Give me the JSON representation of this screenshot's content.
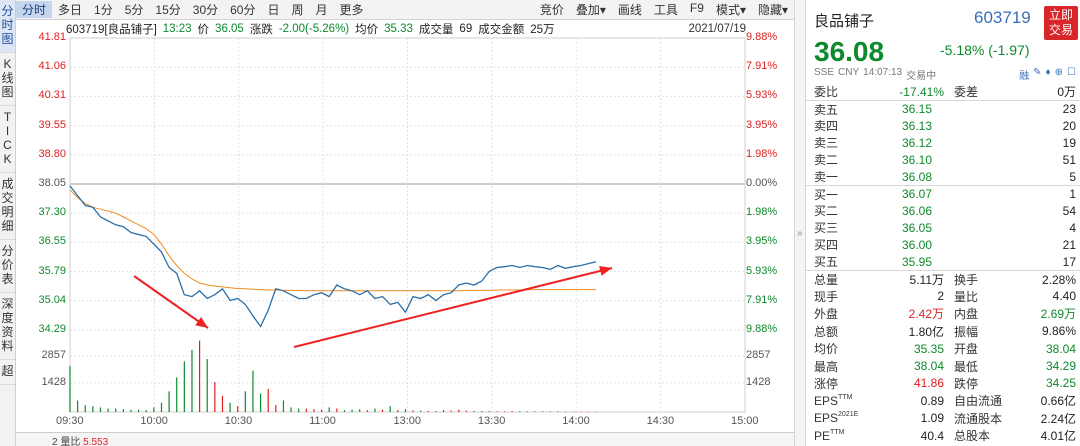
{
  "vtabs": [
    "分\n时\n图",
    "K\n线\n图",
    "T\nI\nC\nK",
    "成\n交\n明\n细",
    "分\n价\n表",
    "深\n度\n资\n料",
    "超"
  ],
  "toolbar": {
    "left": [
      "分时",
      "多日",
      "1分",
      "5分",
      "15分",
      "30分",
      "60分",
      "日",
      "周",
      "月",
      "更多"
    ],
    "right": [
      "竞价",
      "叠加▾",
      "画线",
      "工具",
      "F9",
      "模式▾",
      "隐藏▾"
    ]
  },
  "info": {
    "code_name": "603719[良品铺子]",
    "time": "13:23",
    "price_label": "价",
    "price": "36.05",
    "chg_label": "涨跌",
    "chg": "-2.00(-5.26%)",
    "avg_label": "均价",
    "avg": "35.33",
    "vol_label": "成交量",
    "vol": "69",
    "amt_label": "成交金额",
    "amt": "25万",
    "date": "2021/07/19"
  },
  "chart_data": {
    "type": "line",
    "prev_close": 38.05,
    "ylim": [
      34.29,
      41.81
    ],
    "y_ticks_left": [
      "41.81",
      "41.06",
      "40.31",
      "39.55",
      "38.80",
      "38.05",
      "37.30",
      "36.55",
      "35.79",
      "35.04",
      "34.29"
    ],
    "y_ticks_right": [
      "9.88%",
      "7.91%",
      "5.93%",
      "3.95%",
      "1.98%",
      "0.00%",
      "1.98%",
      "3.95%",
      "5.93%",
      "7.91%",
      "9.88%"
    ],
    "vol_ticks": [
      "2857",
      "1428"
    ],
    "x_ticks": [
      "09:30",
      "10:00",
      "10:30",
      "11:00",
      "13:00",
      "13:30",
      "14:00",
      "14:30",
      "15:00"
    ],
    "price_series": {
      "name": "",
      "values": [
        38.0,
        37.75,
        37.5,
        37.45,
        37.2,
        37.1,
        37.0,
        36.95,
        36.8,
        36.75,
        36.7,
        36.5,
        36.3,
        35.9,
        35.75,
        35.2,
        35.15,
        35.3,
        35.1,
        35.2,
        35.35,
        35.05,
        35.1,
        34.95,
        34.65,
        34.38,
        34.8,
        35.35,
        35.3,
        35.2,
        35.1,
        35.1,
        35.2,
        35.25,
        35.15,
        35.45,
        35.35,
        35.3,
        35.2,
        35.3,
        35.1,
        35.15,
        34.95,
        35.0,
        34.75,
        35.15,
        35.1,
        35.2,
        35.05,
        35.2,
        35.25,
        35.45,
        35.5,
        35.45,
        35.55,
        35.8,
        35.9,
        35.92,
        35.95,
        35.9,
        35.95,
        35.92,
        35.9,
        35.85,
        35.95,
        35.88,
        35.92,
        35.95,
        36.0,
        36.05
      ]
    },
    "avg_series": {
      "name": "",
      "values": [
        37.9,
        37.7,
        37.55,
        37.45,
        37.4,
        37.35,
        37.3,
        37.2,
        37.1,
        37.0,
        36.9,
        36.75,
        36.5,
        36.2,
        35.95,
        35.75,
        35.6,
        35.5,
        35.45,
        35.42,
        35.4,
        35.38,
        35.36,
        35.35,
        35.34,
        35.33,
        35.32,
        35.32,
        35.31,
        35.31,
        35.31,
        35.3,
        35.3,
        35.3,
        35.3,
        35.3,
        35.3,
        35.3,
        35.3,
        35.3,
        35.3,
        35.3,
        35.3,
        35.3,
        35.3,
        35.3,
        35.3,
        35.3,
        35.3,
        35.3,
        35.3,
        35.3,
        35.31,
        35.31,
        35.31,
        35.31,
        35.32,
        35.32,
        35.32,
        35.32,
        35.33,
        35.33,
        35.33,
        35.33,
        35.33,
        35.33,
        35.33,
        35.33,
        35.33,
        35.33
      ]
    },
    "volume": [
      2000,
      500,
      300,
      250,
      200,
      150,
      150,
      120,
      100,
      100,
      80,
      200,
      400,
      900,
      1500,
      2200,
      2700,
      3100,
      2300,
      1300,
      700,
      400,
      250,
      900,
      1800,
      800,
      1000,
      300,
      500,
      200,
      150,
      150,
      120,
      100,
      200,
      150,
      80,
      100,
      120,
      80,
      150,
      100,
      250,
      80,
      120,
      70,
      60,
      50,
      40,
      80,
      60,
      100,
      60,
      50,
      40,
      40,
      30,
      30,
      40,
      30,
      30,
      30,
      30,
      30,
      30,
      20,
      20,
      20,
      20,
      20
    ]
  },
  "bottombar": {
    "label": "2 量比",
    "value": "5.553"
  },
  "panel": {
    "name": "良品铺子",
    "code": "603719",
    "trade_btn": "立即\n交易",
    "price": "36.08",
    "change": "-5.18% (-1.97)",
    "sub": [
      "SSE",
      "CNY",
      "14:07:13",
      "交易中"
    ],
    "sub_tools": [
      "融",
      "✎",
      "♦",
      "⊕",
      "☐"
    ],
    "weibi": {
      "label": "委比",
      "value": "-17.41%",
      "label2": "委差",
      "value2": "0万"
    },
    "sells": [
      {
        "label": "卖五",
        "price": "36.15",
        "vol": "23"
      },
      {
        "label": "卖四",
        "price": "36.13",
        "vol": "20"
      },
      {
        "label": "卖三",
        "price": "36.12",
        "vol": "19"
      },
      {
        "label": "卖二",
        "price": "36.10",
        "vol": "51"
      },
      {
        "label": "卖一",
        "price": "36.08",
        "vol": "5"
      }
    ],
    "buys": [
      {
        "label": "买一",
        "price": "36.07",
        "vol": "1"
      },
      {
        "label": "买二",
        "price": "36.06",
        "vol": "54"
      },
      {
        "label": "买三",
        "price": "36.05",
        "vol": "4"
      },
      {
        "label": "买四",
        "price": "36.00",
        "vol": "21"
      },
      {
        "label": "买五",
        "price": "35.95",
        "vol": "17"
      }
    ],
    "stats": [
      {
        "l1": "总量",
        "v1": "5.11万",
        "c1": "k",
        "l2": "换手",
        "v2": "2.28%",
        "c2": "k"
      },
      {
        "l1": "现手",
        "v1": "2",
        "c1": "k",
        "l2": "量比",
        "v2": "4.40",
        "c2": "k"
      },
      {
        "l1": "外盘",
        "v1": "2.42万",
        "c1": "r",
        "l2": "内盘",
        "v2": "2.69万",
        "c2": "g"
      },
      {
        "l1": "总额",
        "v1": "1.80亿",
        "c1": "k",
        "l2": "振幅",
        "v2": "9.86%",
        "c2": "k"
      },
      {
        "l1": "均价",
        "v1": "35.35",
        "c1": "g",
        "l2": "开盘",
        "v2": "38.04",
        "c2": "g"
      },
      {
        "l1": "最高",
        "v1": "38.04",
        "c1": "g",
        "l2": "最低",
        "v2": "34.29",
        "c2": "g"
      },
      {
        "l1": "涨停",
        "v1": "41.86",
        "c1": "r",
        "l2": "跌停",
        "v2": "34.25",
        "c2": "g"
      },
      {
        "l1": "EPS",
        "s1": "TTM",
        "v1": "0.89",
        "c1": "k",
        "l2": "自由流通",
        "v2": "0.66亿",
        "c2": "k"
      },
      {
        "l1": "EPS",
        "s1": "2021E",
        "v1": "1.09",
        "c1": "k",
        "l2": "流通股本",
        "v2": "2.24亿",
        "c2": "k"
      },
      {
        "l1": "PE",
        "s1": "TTM",
        "v1": "40.4",
        "c1": "k",
        "l2": "总股本",
        "v2": "4.01亿",
        "c2": "k"
      }
    ]
  },
  "colors": {
    "price_line": "#2a6fa8",
    "avg_line": "#f08a24",
    "up": "#e02020",
    "down": "#0d8a2c",
    "annotation_arrow": "#ee2222"
  }
}
